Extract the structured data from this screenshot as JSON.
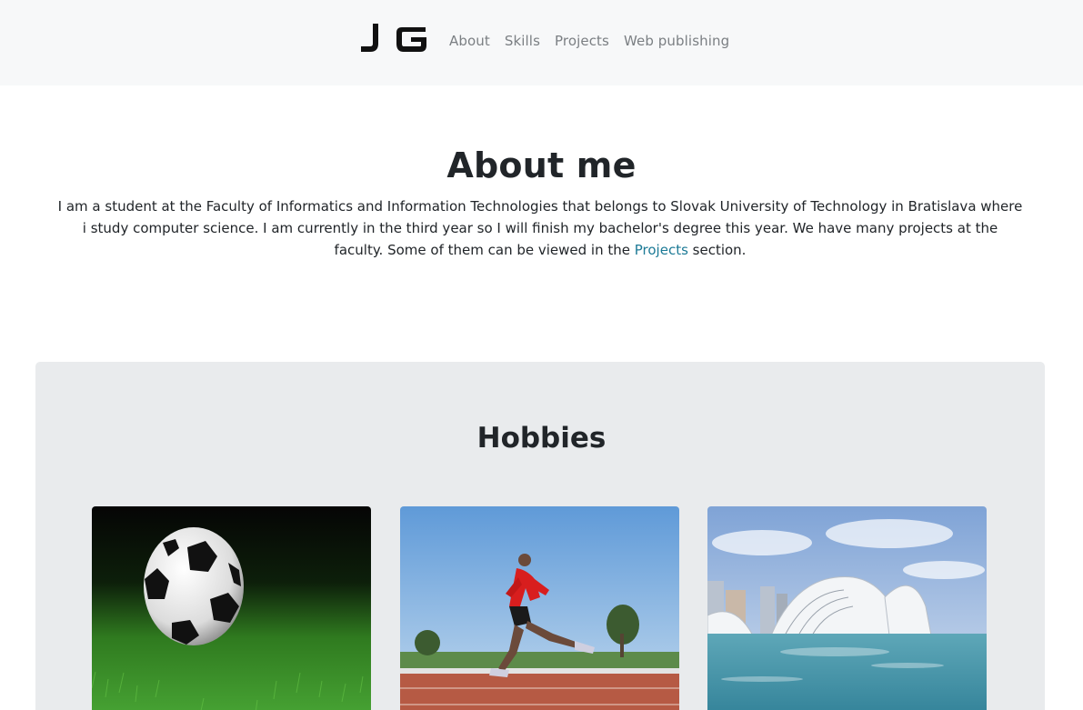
{
  "header": {
    "logo_text": "JG",
    "nav": [
      {
        "label": "About"
      },
      {
        "label": "Skills"
      },
      {
        "label": "Projects"
      },
      {
        "label": "Web publishing"
      }
    ]
  },
  "about": {
    "title": "About me",
    "text_before_link": "I am a student at the Faculty of Informatics and Information Technologies that belongs to Slovak University of Technology in Bratislava where i study computer science. I am currently in the third year so I will finish my bachelor's degree this year. We have many projects at the faculty. Some of them can be viewed in the ",
    "link_text": "Projects",
    "text_after_link": " section."
  },
  "hobbies": {
    "title": "Hobbies",
    "images": [
      {
        "icon": "soccer-ball-image"
      },
      {
        "icon": "runner-image"
      },
      {
        "icon": "architecture-image"
      }
    ]
  },
  "colors": {
    "navbar_bg": "#f7f8f9",
    "link": "#1c7a96",
    "hobbies_bg": "#e9ebed"
  }
}
